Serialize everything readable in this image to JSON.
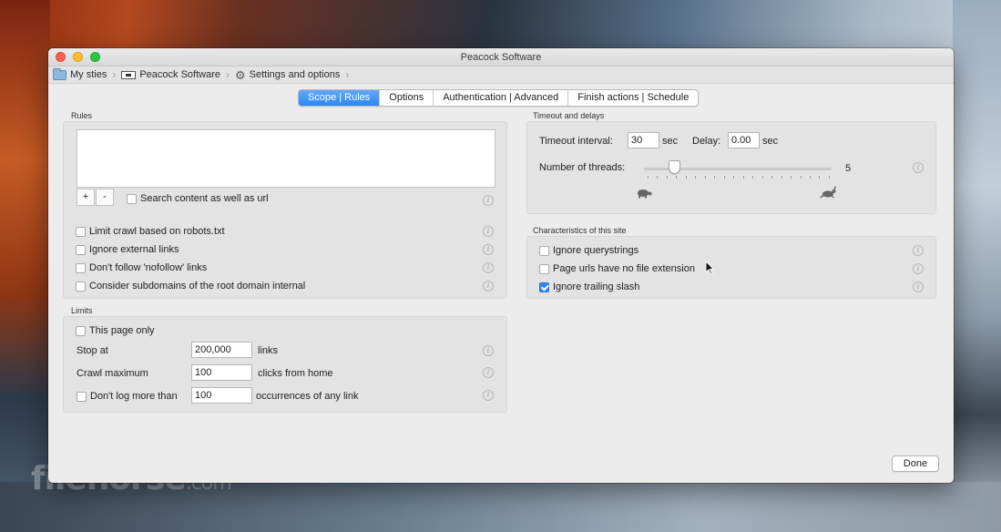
{
  "window": {
    "title": "Peacock Software"
  },
  "breadcrumb": {
    "items": [
      {
        "label": "My sties",
        "icon": "folder-icon"
      },
      {
        "label": "Peacock Software",
        "icon": "site-icon"
      },
      {
        "label": "Settings and options",
        "icon": "gear-icon"
      }
    ]
  },
  "tabs": [
    {
      "label": "Scope | Rules",
      "active": true
    },
    {
      "label": "Options",
      "active": false
    },
    {
      "label": "Authentication | Advanced",
      "active": false
    },
    {
      "label": "Finish actions | Schedule",
      "active": false
    }
  ],
  "rules": {
    "section_title": "Rules",
    "add_label": "+",
    "remove_label": "-",
    "search_content_label": "Search content as well as url",
    "search_content_checked": false,
    "options": [
      {
        "label": "Limit crawl based on robots.txt",
        "checked": false
      },
      {
        "label": "Ignore external links",
        "checked": false
      },
      {
        "label": "Don't follow 'nofollow' links",
        "checked": false
      },
      {
        "label": "Consider subdomains of the root domain internal",
        "checked": false
      }
    ]
  },
  "limits": {
    "section_title": "Limits",
    "this_page_only_label": "This page only",
    "this_page_only_checked": false,
    "stop_at_label": "Stop at",
    "stop_at_value": "200,000",
    "stop_at_unit": "links",
    "crawl_max_label": "Crawl maximum",
    "crawl_max_value": "100",
    "crawl_max_unit": "clicks from home",
    "dont_log_label": "Don't log more than",
    "dont_log_checked": false,
    "dont_log_value": "100",
    "dont_log_unit": "occurrences of any link"
  },
  "timeout": {
    "section_title": "Timeout and delays",
    "interval_label": "Timeout interval:",
    "interval_value": "30",
    "interval_unit": "sec",
    "delay_label": "Delay:",
    "delay_value": "0.00",
    "delay_unit": "sec",
    "threads_label": "Number of threads:",
    "threads_value": "5",
    "slow_icon": "turtle-icon",
    "fast_icon": "rabbit-icon"
  },
  "site": {
    "section_title": "Characteristics of this site",
    "options": [
      {
        "label": "Ignore querystrings",
        "checked": false
      },
      {
        "label": "Page urls have no file extension",
        "checked": false
      },
      {
        "label": "Ignore trailing slash",
        "checked": true
      }
    ]
  },
  "footer": {
    "done_label": "Done"
  },
  "watermark": {
    "text": "filehorse",
    "suffix": ".com"
  },
  "colors": {
    "accent": "#2d86f3",
    "window_bg": "#ececec",
    "panel_bg": "#e3e3e3"
  }
}
